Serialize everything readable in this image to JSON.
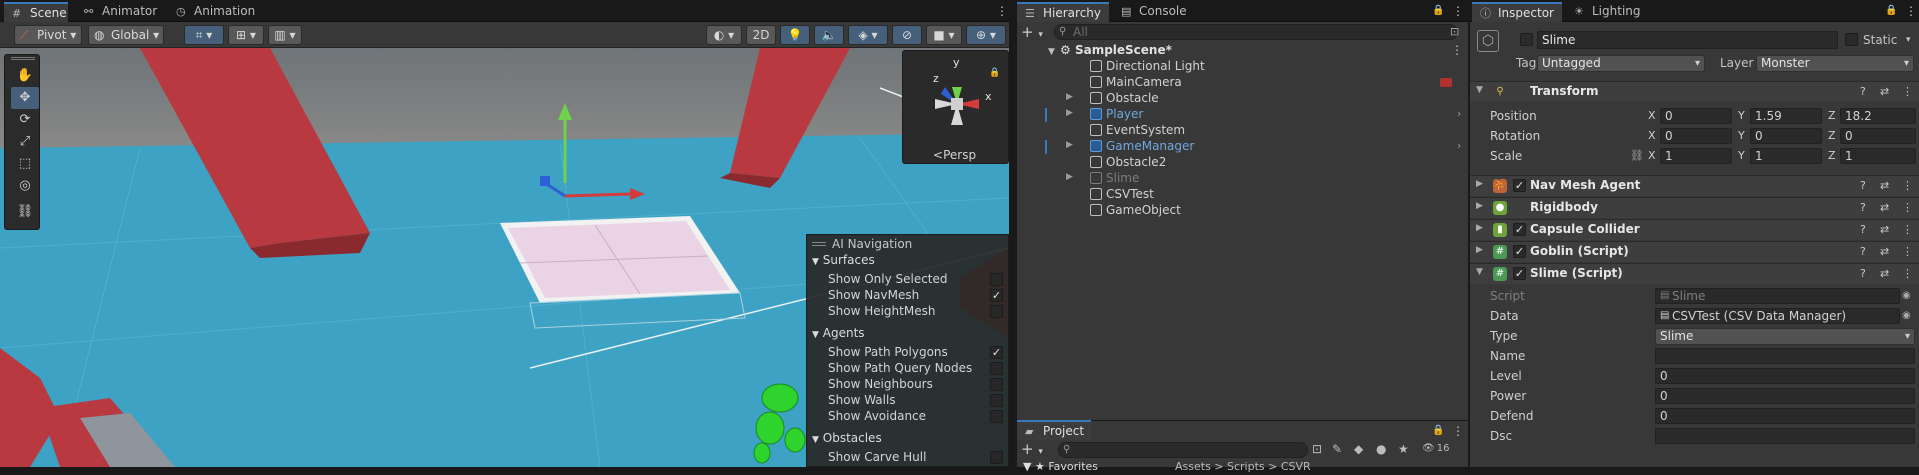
{
  "scene_tabs": {
    "scene": "Scene",
    "animator": "Animator",
    "animation": "Animation"
  },
  "scene_toolbar": {
    "pivot": "Pivot",
    "global": "Global",
    "mode_2d": "2D"
  },
  "gizmo": {
    "y": "y",
    "x": "x",
    "z": "z",
    "persp": "Persp"
  },
  "ai_nav": {
    "title": "AI Navigation",
    "surfaces": "Surfaces",
    "surface_items": [
      {
        "label": "Show Only Selected",
        "checked": false
      },
      {
        "label": "Show NavMesh",
        "checked": true
      },
      {
        "label": "Show HeightMesh",
        "checked": false
      }
    ],
    "agents": "Agents",
    "agent_items": [
      {
        "label": "Show Path Polygons",
        "checked": true
      },
      {
        "label": "Show Path Query Nodes",
        "checked": false
      },
      {
        "label": "Show Neighbours",
        "checked": false
      },
      {
        "label": "Show Walls",
        "checked": false
      },
      {
        "label": "Show Avoidance",
        "checked": false
      }
    ],
    "obstacles": "Obstacles",
    "obstacle_items": [
      {
        "label": "Show Carve Hull",
        "checked": false
      }
    ]
  },
  "hierarchy": {
    "tab": "Hierarchy",
    "console_tab": "Console",
    "search_placeholder": "All",
    "scene_name": "SampleScene*",
    "items": [
      {
        "label": "Directional Light",
        "style": "normal",
        "expand": false
      },
      {
        "label": "MainCamera",
        "style": "normal",
        "expand": false
      },
      {
        "label": "Obstacle",
        "style": "normal",
        "expand": true
      },
      {
        "label": "Player",
        "style": "blue",
        "expand": true
      },
      {
        "label": "EventSystem",
        "style": "normal",
        "expand": false
      },
      {
        "label": "GameManager",
        "style": "blue",
        "expand": true
      },
      {
        "label": "Obstacle2",
        "style": "normal",
        "expand": false
      },
      {
        "label": "Slime",
        "style": "dim",
        "expand": true
      },
      {
        "label": "CSVTest",
        "style": "normal",
        "expand": false
      },
      {
        "label": "GameObject",
        "style": "normal",
        "expand": false
      }
    ]
  },
  "project": {
    "tab": "Project",
    "count": "16",
    "favorites": "Favorites",
    "path": "Assets > Scripts > CSVR"
  },
  "inspector": {
    "tab": "Inspector",
    "lighting_tab": "Lighting",
    "object_name": "Slime",
    "static_label": "Static",
    "tag_label": "Tag",
    "tag_value": "Untagged",
    "layer_label": "Layer",
    "layer_value": "Monster",
    "transform": {
      "title": "Transform",
      "position_label": "Position",
      "rotation_label": "Rotation",
      "scale_label": "Scale",
      "x": "X",
      "y": "Y",
      "z": "Z",
      "position": [
        "0",
        "1.59",
        "18.2"
      ],
      "rotation": [
        "0",
        "0",
        "0"
      ],
      "scale": [
        "1",
        "1",
        "1"
      ]
    },
    "components": [
      {
        "name": "Nav Mesh Agent",
        "checkbox": true,
        "color": "#c0623a",
        "icon": "⛹"
      },
      {
        "name": "Rigidbody",
        "checkbox": false,
        "color": "#6ea23a",
        "icon": "●"
      },
      {
        "name": "Capsule Collider",
        "checkbox": true,
        "color": "#6ea23a",
        "icon": "▮"
      },
      {
        "name": "Goblin (Script)",
        "checkbox": true,
        "color": "#4d9a56",
        "icon": "#"
      },
      {
        "name": "Slime (Script)",
        "checkbox": true,
        "color": "#4d9a56",
        "icon": "#"
      }
    ],
    "slime_script": {
      "script_label": "Script",
      "script_value": "Slime",
      "data_label": "Data",
      "data_value": "CSVTest (CSV Data Manager)",
      "type_label": "Type",
      "type_value": "Slime",
      "name_label": "Name",
      "name_value": "",
      "level_label": "Level",
      "level_value": "0",
      "power_label": "Power",
      "power_value": "0",
      "defend_label": "Defend",
      "defend_value": "0",
      "dsc_label": "Dsc",
      "dsc_value": ""
    }
  },
  "colors": {
    "accent": "#3a79bb",
    "floor": "#3b9fc0",
    "pillar": "#b8393f",
    "navmesh": "#e8cfe0",
    "selected_tool": "#46607c"
  }
}
